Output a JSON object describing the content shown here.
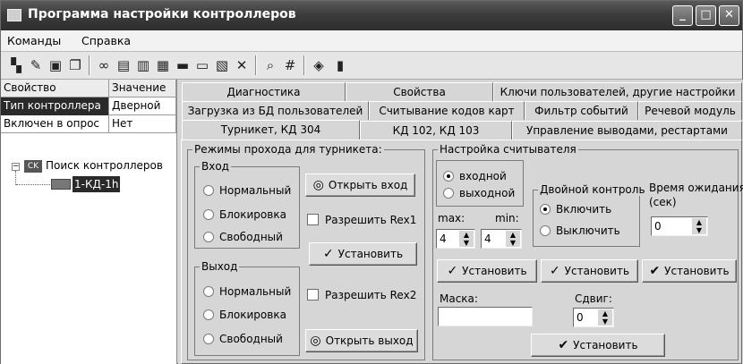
{
  "window": {
    "title": "Программа настройки контроллеров",
    "min_icon": "minimize-icon",
    "max_icon": "maximize-icon",
    "close_icon": "close-icon"
  },
  "menu": {
    "commands": "Команды",
    "help": "Справка"
  },
  "toolbar": {
    "icons": [
      "connect-icon",
      "pen-icon",
      "save-icon",
      "open-folder-icon",
      "binoculars-icon",
      "controller-icon",
      "controller-multi-icon",
      "controller-add-icon",
      "controller-card-icon",
      "controller-card2-icon",
      "controller-edit-icon",
      "delete-icon",
      "find-doc-icon",
      "grid-icon",
      "book-icon",
      "exit-icon"
    ]
  },
  "props": {
    "col_prop": "Свойство",
    "col_value": "Значение",
    "rows": [
      {
        "prop": "Тип контроллера",
        "value": "Дверной"
      },
      {
        "prop": "Включен в опрос",
        "value": "Нет"
      }
    ]
  },
  "tree": {
    "root": "Поиск контроллеров",
    "root_badge": "CK",
    "child": "1-КД-1h"
  },
  "tabs": {
    "row1": [
      "Диагностика",
      "Свойства",
      "Ключи пользователей, другие настройки"
    ],
    "row2": [
      "Загрузка из БД пользователей",
      "Считывание кодов карт",
      "Фильтр событий",
      "Речевой модуль"
    ],
    "row3": [
      "Турникет, КД 304",
      "КД 102, КД 103",
      "Управление выводами, рестартами"
    ]
  },
  "turnstile": {
    "title": "Режимы прохода для турникета:",
    "entry": {
      "title": "Вход",
      "options": [
        "Нормальный",
        "Блокировка",
        "Свободный"
      ]
    },
    "exit": {
      "title": "Выход",
      "options": [
        "Нормальный",
        "Блокировка",
        "Свободный"
      ]
    },
    "open_entry": "Открыть вход",
    "open_exit": "Открыть выход",
    "rex1": "Разрешить Rex1",
    "rex2": "Разрешить Rex2",
    "set": "Установить"
  },
  "reader": {
    "title": "Настройка считывателя",
    "dir_options": [
      "входной",
      "выходной"
    ],
    "double_title": "Двойной контроль",
    "double_options": [
      "Включить",
      "Выключить"
    ],
    "wait_label": "Время ожидания:",
    "wait_unit": "(сек)",
    "wait_value": "0",
    "max_label": "max:",
    "min_label": "min:",
    "max_value": "4",
    "min_value": "4",
    "set": "Установить",
    "mask_label": "Маска:",
    "mask_value": "",
    "shift_label": "Сдвиг:",
    "shift_value": "0"
  }
}
